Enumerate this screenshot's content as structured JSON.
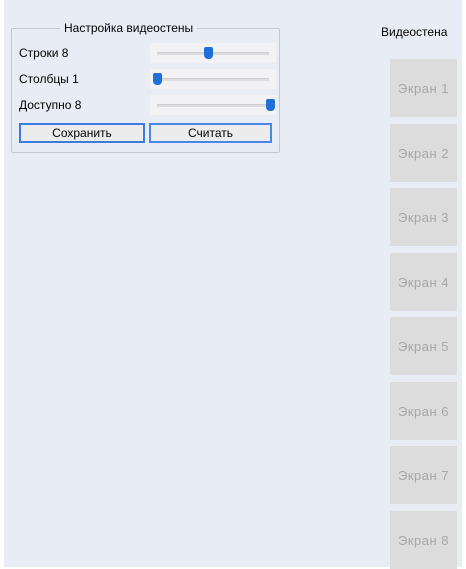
{
  "settings": {
    "title": "Настройка видеостены",
    "rows": {
      "label": "Строки 8",
      "value": 8,
      "fraction": 0.45
    },
    "columns": {
      "label": "Столбцы 1",
      "value": 1,
      "fraction": 0.0
    },
    "available": {
      "label": "Доступно 8",
      "value": 8,
      "fraction": 1.0
    },
    "save_label": "Сохранить",
    "read_label": "Считать"
  },
  "videowall": {
    "title": "Видеостена",
    "screens": [
      "Экран 1",
      "Экран 2",
      "Экран 3",
      "Экран 4",
      "Экран 5",
      "Экран 6",
      "Экран 7",
      "Экран 8"
    ]
  },
  "colors": {
    "background": "#e8ecf4",
    "accent": "#1f6fd8",
    "screen_tile": "#dcdcdc",
    "screen_text": "#a7a7a7"
  }
}
